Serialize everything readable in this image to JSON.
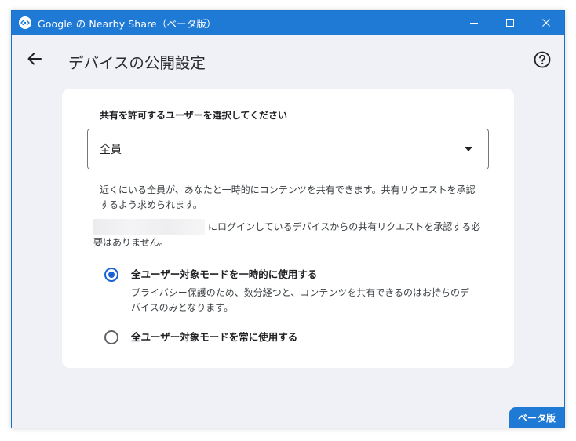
{
  "window": {
    "title": "Google の Nearby Share（ベータ版）",
    "accent_color": "#1f7ad6"
  },
  "header": {
    "back_icon": "arrow-left-icon",
    "title": "デバイスの公開設定",
    "help_icon": "help-circle-icon"
  },
  "card": {
    "section_label": "共有を許可するユーザーを選択してください",
    "dropdown": {
      "selected": "全員",
      "icon": "caret-down-icon"
    },
    "description": "近くにいる全員が、あなたと一時的にコンテンツを共有できます。共有リクエストを承認するよう求められます。",
    "account_note": "にログインしているデバイスからの共有リクエストを承認する必要はありません。",
    "options": [
      {
        "label": "全ユーザー対象モードを一時的に使用する",
        "sub": "プライバシー保護のため、数分経つと、コンテンツを共有できるのはお持ちのデバイスのみとなります。",
        "checked": true
      },
      {
        "label": "全ユーザー対象モードを常に使用する",
        "checked": false
      }
    ]
  },
  "badge": {
    "label": "ベータ版"
  }
}
